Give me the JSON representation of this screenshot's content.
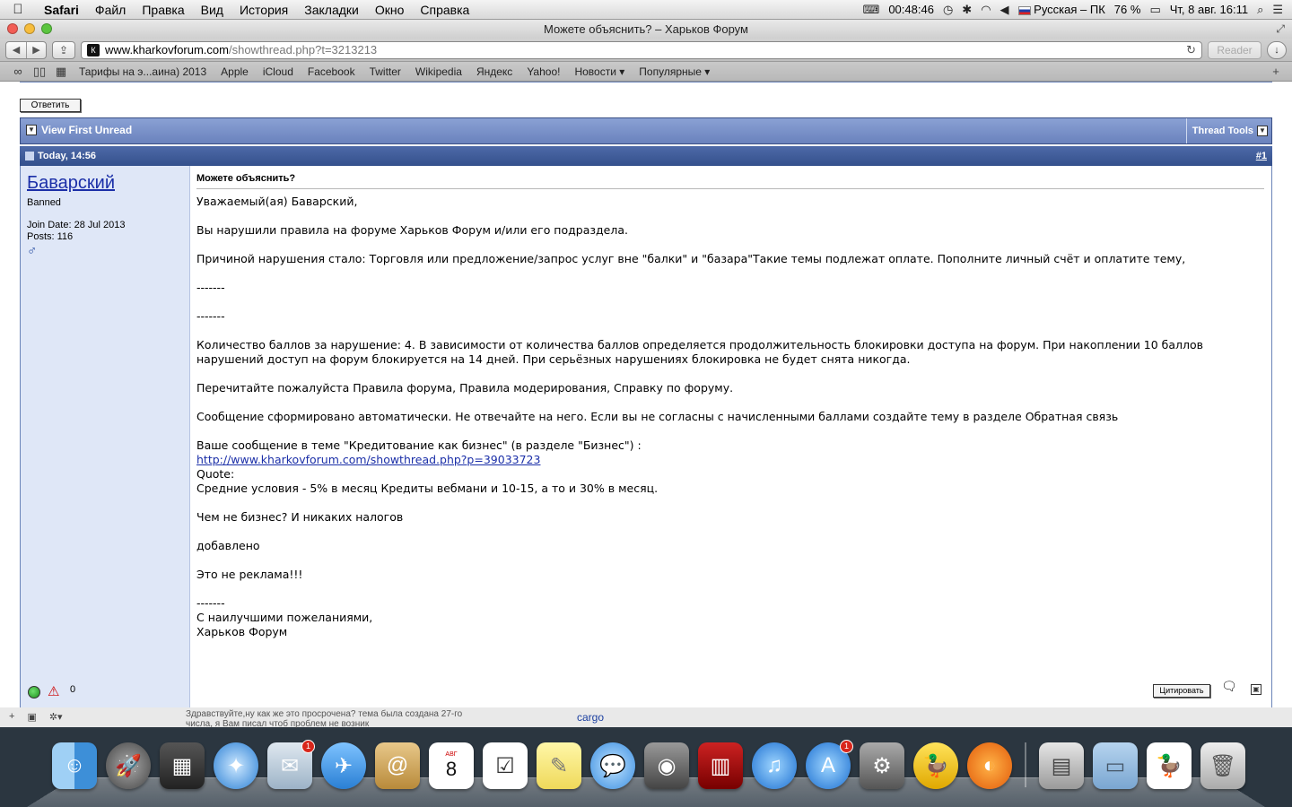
{
  "menubar": {
    "app": "Safari",
    "items": [
      "Файл",
      "Правка",
      "Вид",
      "История",
      "Закладки",
      "Окно",
      "Справка"
    ],
    "battery_time": "00:48:46",
    "input_source": "Русская – ПК",
    "battery_percent": "76 %",
    "datetime": "Чт, 8 авг.  16:11"
  },
  "window": {
    "title": "Можете объяснить? – Харьков Форум",
    "address_host": "www.kharkovforum.com",
    "address_path": "/showthread.php?t=3213213",
    "reader_label": "Reader"
  },
  "bookmarks": [
    "Тарифы на э...аина) 2013",
    "Apple",
    "iCloud",
    "Facebook",
    "Twitter",
    "Wikipedia",
    "Яндекс",
    "Yahoo!",
    "Новости ▾",
    "Популярные ▾"
  ],
  "forum": {
    "reply_label": "Ответить",
    "view_first_unread": "View First Unread",
    "thread_tools": "Thread Tools",
    "post_date": "Today, 14:56",
    "post_number": "#1",
    "user": {
      "name": "Баварский",
      "status": "Banned",
      "join_date": "Join Date: 28 Jul 2013",
      "posts": "Posts: 116",
      "gender_icon": "♂",
      "ip_icon_text": "0"
    },
    "subject": "Можете объяснить?",
    "body": {
      "p1": "Уважаемый(ая) Баварский,",
      "p2": "Вы нарушили правила на форуме Харьков Форум и/или его подраздела.",
      "p3": "Причиной нарушения стало: Торговля или предложение/запрос услуг вне \"балки\" и \"базара\"Такие темы подлежат оплате. Пополните личный счёт и оплатите тему,",
      "sep1": "-------",
      "sep2": "-------",
      "p4": "Количество баллов за нарушение: 4. В зависимости от количества баллов определяется продолжительность блокировки доступа на форум. При накоплении 10 баллов нарушений доступ на форум блокируется на 14 дней. При серьёзных нарушениях блокировка не будет снята никогда.",
      "p5": "Перечитайте пожалуйста Правила форума, Правила модерирования, Справку по форуму.",
      "p6": "Сообщение сформировано автоматически. Не отвечайте на него. Если вы не согласны с начисленными баллами создайте тему в разделе Обратная связь",
      "p7_line1": "Ваше сообщение в теме \"Кредитование как бизнес\" (в разделе \"Бизнес\") :",
      "p7_link": "http://www.kharkovforum.com/showthread.php?p=39033723",
      "p7_quote": "Quote:",
      "p7_text": "Средние условия - 5% в месяц Кредиты вебмани и 10-15, а то и 30% в месяц.",
      "p8": "Чем не бизнес? И никаких налогов",
      "p9": "добавлено",
      "p10": "Это не реклама!!!",
      "sep3": "-------",
      "sign1": "С наилучшими пожеланиями,",
      "sign2": "Харьков Форум"
    },
    "quote_label": "Цитировать"
  },
  "behind": {
    "snippet": "Здравствуйте,ну как же это просрочена? тема была создана 27-го числа, я Вам писал чтоб проблем не возник",
    "cargo": "cargo"
  },
  "dock": {
    "mail_badge": "1",
    "calendar_day": "8",
    "calendar_month": "АВГ",
    "appstore_badge": "1"
  },
  "colors": {
    "thread_bar": "#7a92c9",
    "post_header": "#3f5b98",
    "userinfo_bg": "#dfe7f7",
    "link": "#1b2fa8"
  }
}
